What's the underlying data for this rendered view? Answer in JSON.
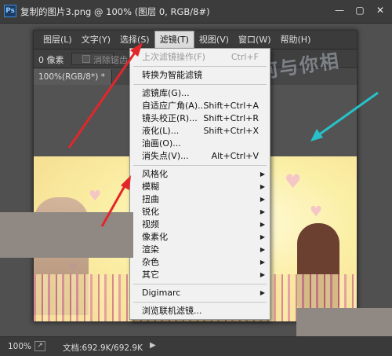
{
  "window": {
    "title": "复制的图片3.png @ 100% (图层 0, RGB/8#)",
    "logo": "Ps",
    "minimize_icon": "minimize-icon",
    "maximize_icon": "maximize-icon",
    "close_icon": "close-icon"
  },
  "inner_menubar": {
    "items": [
      {
        "label": "图层(L)"
      },
      {
        "label": "文字(Y)"
      },
      {
        "label": "选择(S)"
      },
      {
        "label": "滤镜(T)",
        "active": true
      },
      {
        "label": "视图(V)"
      },
      {
        "label": "窗口(W)"
      },
      {
        "label": "帮助(H)"
      }
    ]
  },
  "options_bar": {
    "feather_value": "0 像素",
    "antialias_label": "消除锯齿"
  },
  "document_tab": {
    "label": "100%(RGB/8*) *"
  },
  "filter_menu": {
    "items": [
      {
        "label": "上次滤镜操作(F)",
        "shortcut": "Ctrl+F",
        "disabled": true
      },
      {
        "label": "转换为智能滤镜"
      },
      {
        "label": "滤镜库(G)..."
      },
      {
        "label": "自适应广角(A)...",
        "shortcut": "Shift+Ctrl+A"
      },
      {
        "label": "镜头校正(R)...",
        "shortcut": "Shift+Ctrl+R"
      },
      {
        "label": "液化(L)...",
        "shortcut": "Shift+Ctrl+X"
      },
      {
        "label": "油画(O)..."
      },
      {
        "label": "消失点(V)...",
        "shortcut": "Alt+Ctrl+V"
      },
      {
        "label": "风格化",
        "submenu": true
      },
      {
        "label": "模糊",
        "submenu": true
      },
      {
        "label": "扭曲",
        "submenu": true
      },
      {
        "label": "锐化",
        "submenu": true
      },
      {
        "label": "视频",
        "submenu": true
      },
      {
        "label": "像素化",
        "submenu": true
      },
      {
        "label": "渲染",
        "submenu": true
      },
      {
        "label": "杂色",
        "submenu": true
      },
      {
        "label": "其它",
        "submenu": true
      },
      {
        "label": "Digimarc",
        "submenu": true
      },
      {
        "label": "浏览联机滤镜..."
      }
    ],
    "submenu_arrow": "▶"
  },
  "status_bar": {
    "zoom": "100%",
    "export_icon": "export-icon",
    "doc_info": "文档:692.9K/692.9K",
    "more_arrow": "▶"
  },
  "watermark": {
    "text": "天下何与你相"
  },
  "colors": {
    "arrow_red": "#e3262a",
    "arrow_cyan": "#27c2c9",
    "menu_bg": "#f1f1f1",
    "chrome_dark": "#3b3b3b"
  }
}
